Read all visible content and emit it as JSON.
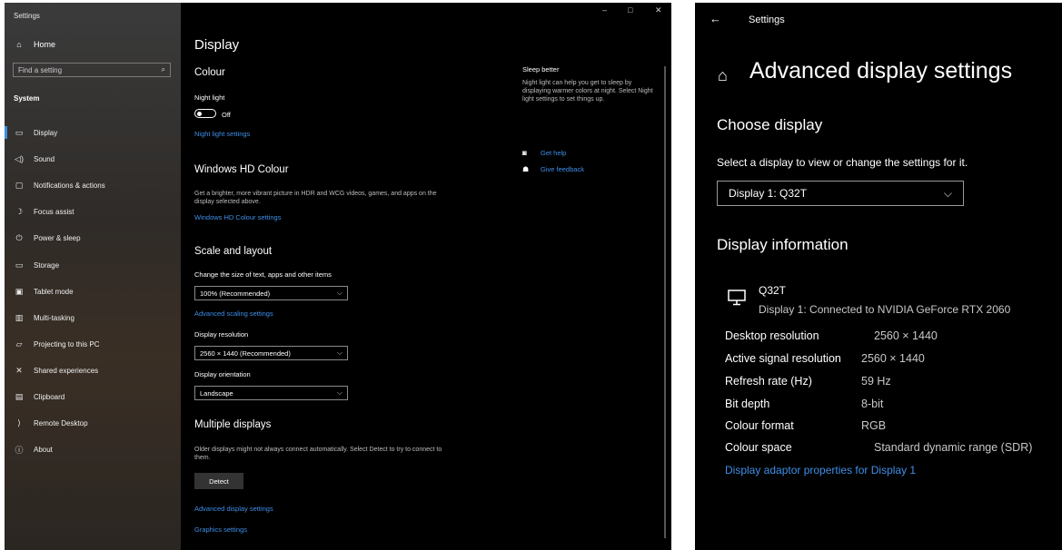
{
  "left_window": {
    "title": "Settings",
    "sidebar": {
      "home_label": "Home",
      "search_placeholder": "Find a setting",
      "section": "System",
      "items": [
        {
          "label": "Display",
          "icon": "monitor-icon",
          "active": true
        },
        {
          "label": "Sound",
          "icon": "speaker-icon"
        },
        {
          "label": "Notifications & actions",
          "icon": "message-icon"
        },
        {
          "label": "Focus assist",
          "icon": "moon-icon"
        },
        {
          "label": "Power & sleep",
          "icon": "power-icon"
        },
        {
          "label": "Storage",
          "icon": "drive-icon"
        },
        {
          "label": "Tablet mode",
          "icon": "tablet-icon"
        },
        {
          "label": "Multi-tasking",
          "icon": "multitask-icon"
        },
        {
          "label": "Projecting to this PC",
          "icon": "projector-icon"
        },
        {
          "label": "Shared experiences",
          "icon": "share-icon"
        },
        {
          "label": "Clipboard",
          "icon": "clipboard-icon"
        },
        {
          "label": "Remote Desktop",
          "icon": "remote-icon"
        },
        {
          "label": "About",
          "icon": "info-icon"
        }
      ]
    },
    "main": {
      "page_title": "Display",
      "colour": {
        "heading": "Colour",
        "night_light_label": "Night light",
        "toggle_state": "Off",
        "settings_link": "Night light settings"
      },
      "hd": {
        "heading": "Windows HD Colour",
        "description": "Get a brighter, more vibrant picture in HDR and WCG videos, games, and apps on the display selected above.",
        "link": "Windows HD Colour settings"
      },
      "scale": {
        "heading": "Scale and layout",
        "size_label": "Change the size of text, apps and other items",
        "size_value": "100% (Recommended)",
        "advanced_link": "Advanced scaling settings",
        "resolution_label": "Display resolution",
        "resolution_value": "2560 × 1440 (Recommended)",
        "orientation_label": "Display orientation",
        "orientation_value": "Landscape"
      },
      "multiple": {
        "heading": "Multiple displays",
        "description": "Older displays might not always connect automatically. Select Detect to try to connect to them.",
        "detect_button": "Detect",
        "advanced_link": "Advanced display settings",
        "graphics_link": "Graphics settings"
      },
      "aside": {
        "title": "Sleep better",
        "text": "Night light can help you get to sleep by displaying warmer colors at night. Select Night light settings to set things up.",
        "help_link": "Get help",
        "feedback_link": "Give feedback"
      },
      "window_controls": {
        "minimize": "–",
        "maximize": "□",
        "close": "✕"
      }
    }
  },
  "right_window": {
    "app_title": "Settings",
    "page_title": "Advanced display settings",
    "choose": {
      "heading": "Choose display",
      "text": "Select a display to view or change the settings for it.",
      "selected": "Display 1: Q32T"
    },
    "info": {
      "heading": "Display information",
      "monitor_name": "Q32T",
      "monitor_sub": "Display 1: Connected to NVIDIA GeForce RTX 2060",
      "rows": [
        {
          "key": "Desktop resolution",
          "value": "2560 × 1440"
        },
        {
          "key": "Active signal resolution",
          "value": "2560 × 1440"
        },
        {
          "key": "Refresh rate (Hz)",
          "value": "59 Hz"
        },
        {
          "key": "Bit depth",
          "value": "8-bit"
        },
        {
          "key": "Colour format",
          "value": "RGB"
        },
        {
          "key": "Colour space",
          "value": "Standard dynamic range (SDR)"
        }
      ],
      "adaptor_link": "Display adaptor properties for Display 1"
    }
  },
  "colors": {
    "accent": "#3f8fe8",
    "background": "#000000"
  }
}
